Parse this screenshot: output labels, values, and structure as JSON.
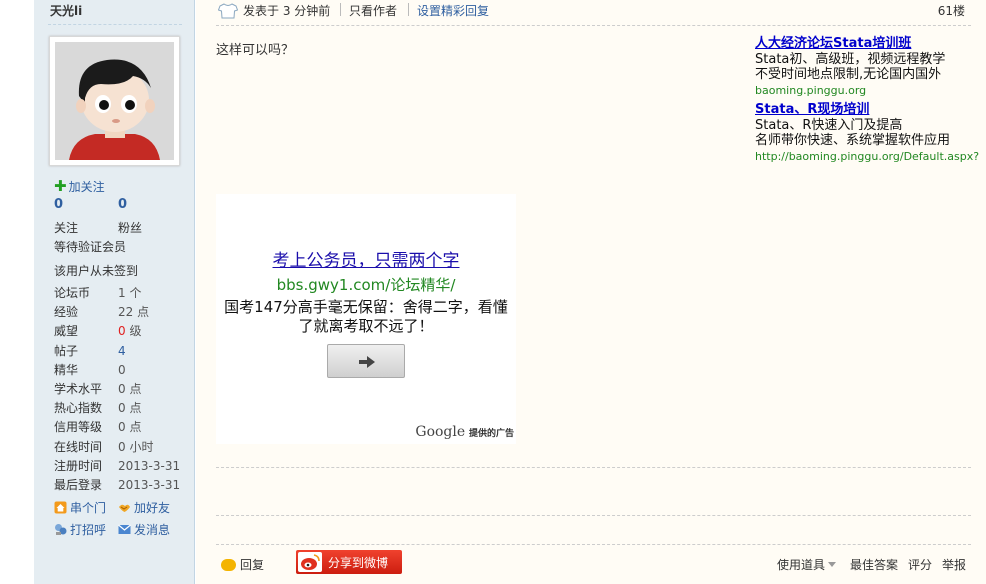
{
  "author": {
    "name": "天光li",
    "follow_label": "加关注",
    "following_count": "0",
    "fans_count": "0",
    "following_label": "关注",
    "fans_label": "粉丝",
    "member_level": "等待验证会员",
    "checkin_status": "该用户从未签到"
  },
  "stats": [
    {
      "key": "论坛币",
      "value": "1",
      "unit": "个"
    },
    {
      "key": "经验",
      "value": "22",
      "unit": "点"
    },
    {
      "key": "威望",
      "value": "0",
      "unit": "级"
    },
    {
      "key": "帖子",
      "value": "4",
      "unit": ""
    },
    {
      "key": "精华",
      "value": "0",
      "unit": ""
    },
    {
      "key": "学术水平",
      "value": "0",
      "unit": "点"
    },
    {
      "key": "热心指数",
      "value": "0",
      "unit": "点"
    },
    {
      "key": "信用等级",
      "value": "0",
      "unit": "点"
    },
    {
      "key": "在线时间",
      "value": "0",
      "unit": "小时"
    },
    {
      "key": "注册时间",
      "value": "2013-3-31",
      "unit": ""
    },
    {
      "key": "最后登录",
      "value": "2013-3-31",
      "unit": ""
    }
  ],
  "actions": {
    "visit": "串个门",
    "add_friend": "加好友",
    "greet": "打招呼",
    "message": "发消息"
  },
  "post": {
    "posted_at": "发表于 3 分钟前",
    "only_author": "只看作者",
    "set_best": "设置精彩回复",
    "floor": "61楼",
    "text": "这样可以吗？"
  },
  "ads_right": [
    {
      "title": "人大经济论坛Stata培训班",
      "lines": [
        "Stata初、高级班，视频远程教学",
        "不受时间地点限制,无论国内国外"
      ],
      "url": "baoming.pinggu.org"
    },
    {
      "title": "Stata、R现场培训",
      "lines": [
        "Stata、R快速入门及提高",
        "名师带你快速、系统掌握软件应用"
      ],
      "url": "http://baoming.pinggu.org/Default.aspx?"
    }
  ],
  "ad_box": {
    "title": "考上公务员，只需两个字",
    "url": "bbs.gwy1.com/论坛精华/",
    "desc": "国考147分高手毫无保留：舍得二字，看懂了就离考取不远了！",
    "brand": "Google",
    "sponsor": "提供的广告"
  },
  "footer": {
    "reply": "回复",
    "share": "分享到微博",
    "tools": "使用道具",
    "best_answer": "最佳答案",
    "rate": "评分",
    "report": "举报"
  },
  "colors": {
    "sidebar_bg": "#e5edf2",
    "main_bg": "#fffcf5",
    "link_blue": "#2f5fa0",
    "ad_title": "#0000cc",
    "ad_url": "#228822",
    "share_red": "#e0301e"
  }
}
